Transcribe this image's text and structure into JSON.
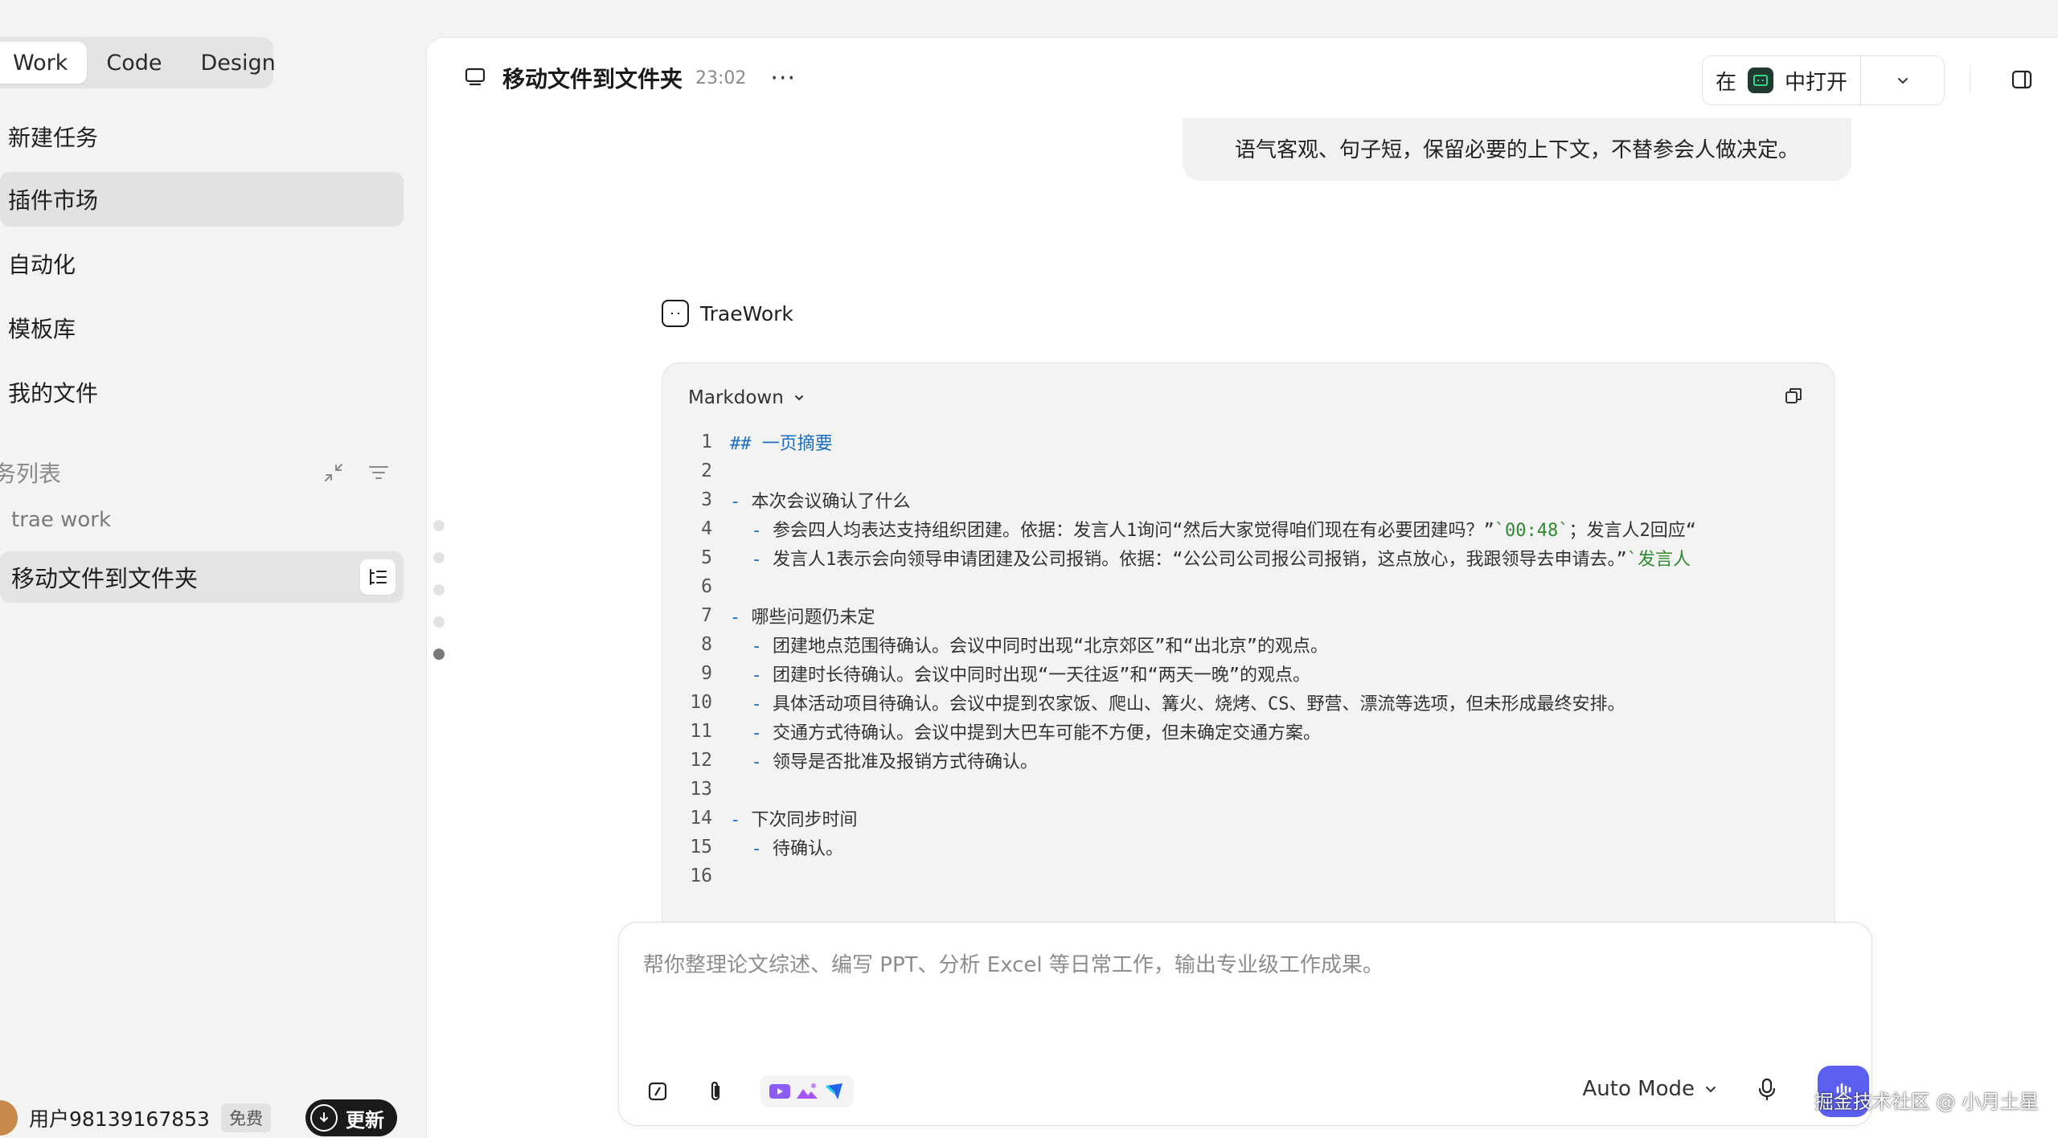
{
  "sidebar": {
    "modes": [
      "Work",
      "Code",
      "Design"
    ],
    "active_mode": "Work",
    "nav": [
      {
        "label": "新建任务"
      },
      {
        "label": "插件市场"
      },
      {
        "label": "自动化"
      },
      {
        "label": "模板库"
      },
      {
        "label": "我的文件"
      }
    ],
    "section_title": "务列表",
    "group_label": "trae work",
    "task_title": "移动文件到文件夹",
    "user": {
      "name": "用户98139167853",
      "plan": "免费",
      "update_label": "更新"
    }
  },
  "header": {
    "title": "移动文件到文件夹",
    "time": "23:02",
    "more": "···",
    "open_in_prefix": "在",
    "open_in_suffix": "中打开"
  },
  "chat": {
    "user_message_tail": "语气客观、句子短，保留必要的上下文，不替参会人做决定。",
    "agent_name": "TraeWork",
    "code_language": "Markdown",
    "code_lines": [
      {
        "n": "1",
        "segments": [
          {
            "t": "## 一页摘要",
            "c": "kw-blue"
          }
        ]
      },
      {
        "n": "2",
        "segments": []
      },
      {
        "n": "3",
        "segments": [
          {
            "t": "- ",
            "c": "kw-dash"
          },
          {
            "t": "本次会议确认了什么",
            "c": ""
          }
        ]
      },
      {
        "n": "4",
        "segments": [
          {
            "t": "  - ",
            "c": "kw-dash"
          },
          {
            "t": "参会四人均表达支持组织团建。依据：发言人1询问“然后大家觉得咱们现在有必要团建吗？”",
            "c": ""
          },
          {
            "t": "`00:48`",
            "c": "kw-green"
          },
          {
            "t": "；发言人2回应“",
            "c": ""
          }
        ]
      },
      {
        "n": "5",
        "segments": [
          {
            "t": "  - ",
            "c": "kw-dash"
          },
          {
            "t": "发言人1表示会向领导申请团建及公司报销。依据：“公公司公司报公司报销，这点放心，我跟领导去申请去。”",
            "c": ""
          },
          {
            "t": "`发言人",
            "c": "kw-green"
          }
        ]
      },
      {
        "n": "6",
        "segments": []
      },
      {
        "n": "7",
        "segments": [
          {
            "t": "- ",
            "c": "kw-dash"
          },
          {
            "t": "哪些问题仍未定",
            "c": ""
          }
        ]
      },
      {
        "n": "8",
        "segments": [
          {
            "t": "  - ",
            "c": "kw-dash"
          },
          {
            "t": "团建地点范围待确认。会议中同时出现“北京郊区”和“出北京”的观点。",
            "c": ""
          }
        ]
      },
      {
        "n": "9",
        "segments": [
          {
            "t": "  - ",
            "c": "kw-dash"
          },
          {
            "t": "团建时长待确认。会议中同时出现“一天往返”和“两天一晚”的观点。",
            "c": ""
          }
        ]
      },
      {
        "n": "10",
        "segments": [
          {
            "t": "  - ",
            "c": "kw-dash"
          },
          {
            "t": "具体活动项目待确认。会议中提到农家饭、爬山、篝火、烧烤、CS、野营、漂流等选项，但未形成最终安排。",
            "c": ""
          }
        ]
      },
      {
        "n": "11",
        "segments": [
          {
            "t": "  - ",
            "c": "kw-dash"
          },
          {
            "t": "交通方式待确认。会议中提到大巴车可能不方便，但未确定交通方案。",
            "c": ""
          }
        ]
      },
      {
        "n": "12",
        "segments": [
          {
            "t": "  - ",
            "c": "kw-dash"
          },
          {
            "t": "领导是否批准及报销方式待确认。",
            "c": ""
          }
        ]
      },
      {
        "n": "13",
        "segments": []
      },
      {
        "n": "14",
        "segments": [
          {
            "t": "- ",
            "c": "kw-dash"
          },
          {
            "t": "下次同步时间",
            "c": ""
          }
        ]
      },
      {
        "n": "15",
        "segments": [
          {
            "t": "  - ",
            "c": "kw-dash"
          },
          {
            "t": "待确认。",
            "c": ""
          }
        ]
      },
      {
        "n": "16",
        "segments": []
      }
    ]
  },
  "composer": {
    "placeholder": "帮你整理论文综述、编写 PPT、分析 Excel 等日常工作，输出专业级工作成果。",
    "mode_label": "Auto Mode"
  },
  "watermark": "掘金技术社区 @ 小月土星",
  "colors": {
    "accent": "#5b5ff0",
    "code_keyword": "#1b6ec2",
    "code_inline": "#2f8a2f"
  }
}
